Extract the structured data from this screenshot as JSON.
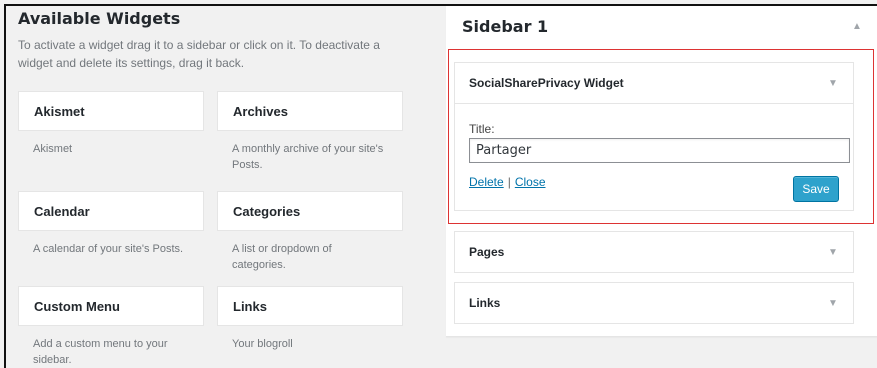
{
  "available_widgets": {
    "title": "Available Widgets",
    "description": "To activate a widget drag it to a sidebar or click on it. To deactivate a widget and delete its settings, drag it back.",
    "items": [
      {
        "title": "Akismet",
        "description": "Akismet"
      },
      {
        "title": "Archives",
        "description": "A monthly archive of your site's Posts."
      },
      {
        "title": "Calendar",
        "description": "A calendar of your site's Posts."
      },
      {
        "title": "Categories",
        "description": "A list or dropdown of categories."
      },
      {
        "title": "Custom Menu",
        "description": "Add a custom menu to your sidebar."
      },
      {
        "title": "Links",
        "description": "Your blogroll"
      }
    ]
  },
  "sidebar": {
    "title": "Sidebar 1",
    "collapse_icon": "up-triangle-icon",
    "widgets": [
      {
        "title": "SocialSharePrivacy Widget",
        "expanded": true,
        "field_label": "Title:",
        "field_value": "Partager",
        "delete_label": "Delete",
        "separator": "|",
        "close_label": "Close",
        "save_label": "Save"
      },
      {
        "title": "Pages",
        "expanded": false
      },
      {
        "title": "Links",
        "expanded": false
      }
    ]
  },
  "colors": {
    "highlight_border": "#dd3333",
    "save_button": "#2ea2cc",
    "link": "#0073aa",
    "background": "#f1f1f1"
  }
}
